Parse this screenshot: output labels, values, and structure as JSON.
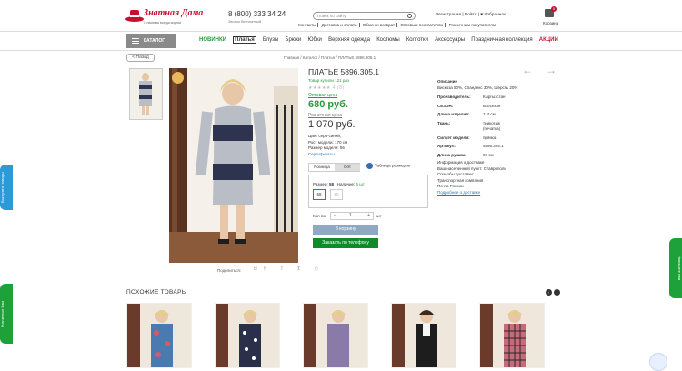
{
  "brand": {
    "name": "Знатная Дама",
    "tagline": "С нами вы всегда модны!"
  },
  "header": {
    "phone": "8 (800) 333 34 24",
    "phone_note": "Звонок бесплатный",
    "search_placeholder": "Поиск по сайту",
    "links": [
      "Контакты",
      "Доставка и оплата",
      "Обмен и возврат",
      "Оптовым покупателям",
      "Розничным покупателям"
    ],
    "auth": "Регистрация | Войти | ♥ Избранное",
    "cart_count": "0",
    "cart_label": "Корзина"
  },
  "nav": {
    "catalog": "КАТАЛОГ",
    "items": [
      "НОВИНКИ",
      "Платья",
      "Блузы",
      "Брюки",
      "Юбки",
      "Верхняя одежда",
      "Костюмы",
      "Колготки",
      "Аксессуары",
      "Праздничная коллекция",
      "АКЦИИ"
    ]
  },
  "back_label": "< Назад",
  "breadcrumb": "Главная  /  Каталог  /  Платья  /  ПЛАТЬЕ 5896.305.1",
  "share_label": "Поделиться:",
  "share_icons": "ВК f 𝕿 ⊙",
  "product": {
    "title": "ПЛАТЬЕ 5896.305.1",
    "bought": "Товар купили 121 раз",
    "stars": "★★★★★ 4 (8)",
    "opt_label": "Оптовая цена",
    "opt_price": "680 руб.",
    "retail_label": "Розничная цена",
    "retail_price": "1 070 руб.",
    "color": "Цвет серо-синий;",
    "model_height": "Рост модели: 170 см",
    "model_size": "Размер модели: 56",
    "certs": "Сертификаты",
    "tab_retail": "Розница",
    "tab_opt": "Опт",
    "size_table": "Таблица размеров",
    "size_label": "Размер:",
    "size_value": "58",
    "avail_label": "Наличие:",
    "avail_value": "5 шт",
    "sizes": [
      "58",
      "60"
    ],
    "qty_label": "Кол-во",
    "qty": "1",
    "qty_unit": "шт",
    "cart_btn": "В корзину",
    "phone_btn": "Заказать по телефону"
  },
  "description": {
    "heading": "Описание",
    "composition": "Вискоза 50%, Спандекс 30%, Шерсть 20%",
    "rows": [
      {
        "k": "Производитель:",
        "v": "Кыргызстан"
      },
      {
        "k": "СЕЗОН:",
        "v": "Всесезон"
      },
      {
        "k": "Длина изделия:",
        "v": "114 см"
      },
      {
        "k": "Ткань:",
        "v": "трикотаж (печатка)"
      },
      {
        "k": "Силуэт модели:",
        "v": "прямой"
      },
      {
        "k": "Артикул:",
        "v": "5896.305.1"
      },
      {
        "k": "Длина рукава:",
        "v": "60 см"
      }
    ],
    "delivery_title": "Информация о доставке",
    "city": "Ваш населенный пункт: Ставрополь",
    "methods": "Способы доставки:",
    "m1": "Транспортная компания",
    "m2": "Почта России",
    "more": "Подробнее о доставке"
  },
  "similar": {
    "title": "ПОХОЖИЕ ТОВАРЫ",
    "prev": "‹",
    "next": "›"
  },
  "side": {
    "left1": "Выгрузить товары",
    "left2": "Розничные Вам",
    "right": "Напишите нам"
  },
  "colors": {
    "green": "#2a9a3a",
    "red": "#c8102e",
    "blue": "#2a7ab8",
    "dark_green": "#118a2a"
  }
}
